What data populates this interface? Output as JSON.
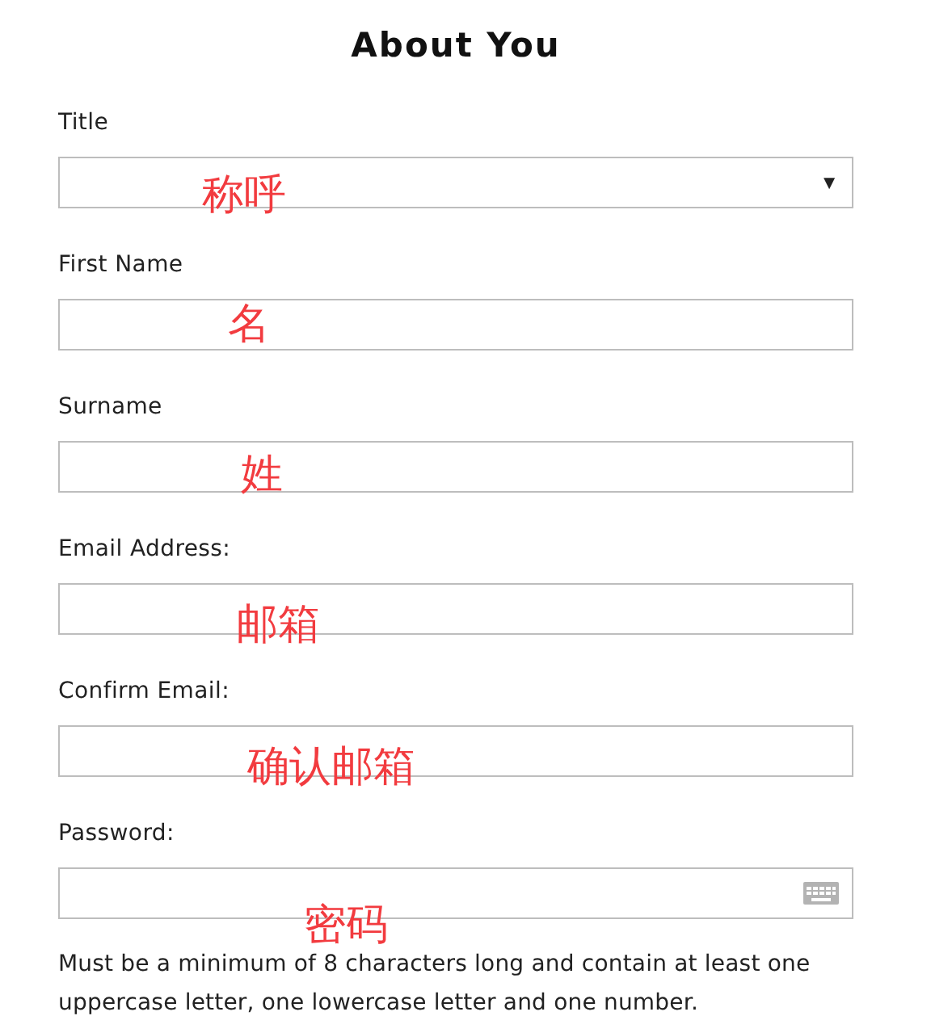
{
  "heading": "About You",
  "fields": [
    {
      "kind": "select",
      "label": "Title",
      "arrow": "▼",
      "annotation": "称呼"
    },
    {
      "kind": "text",
      "label": "First Name",
      "annotation": "名"
    },
    {
      "kind": "text",
      "label": "Surname",
      "annotation": "姓"
    },
    {
      "kind": "text",
      "label": "Email Address:",
      "annotation": "邮箱"
    },
    {
      "kind": "text",
      "label": "Confirm Email:",
      "annotation": "确认邮箱"
    },
    {
      "kind": "password",
      "label": "Password:",
      "annotation": "密码"
    }
  ],
  "help_text": "Must be a minimum of 8 characters long and contain at least one uppercase letter, one lowercase letter and one number."
}
